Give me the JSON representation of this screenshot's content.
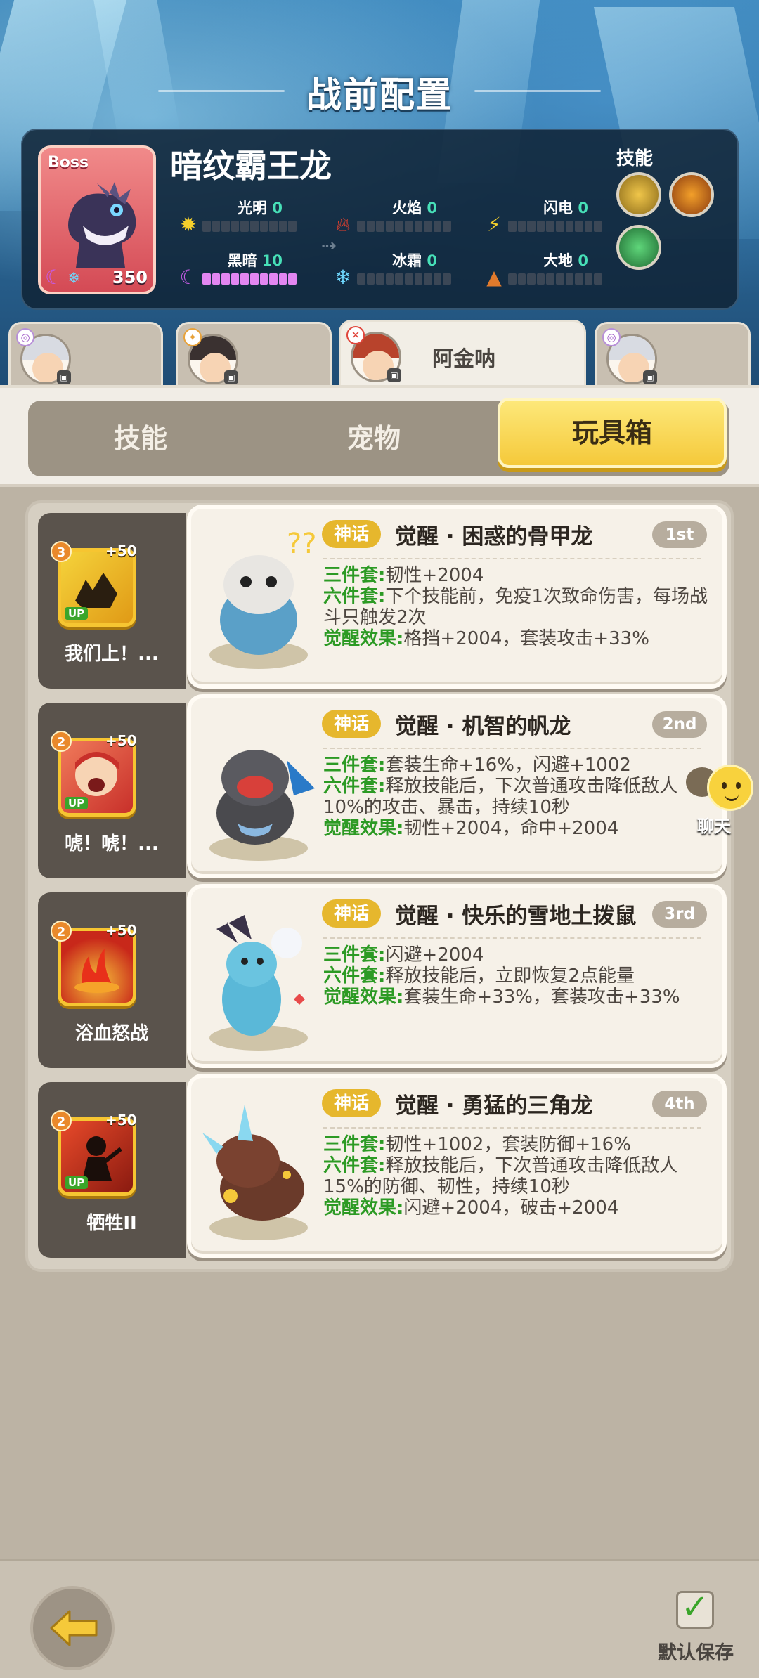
{
  "header": {
    "title": "战前配置"
  },
  "boss": {
    "tag": "Boss",
    "name": "暗纹霸王龙",
    "level": "350",
    "elements": [
      {
        "name": "光明",
        "value": "0",
        "filled": 0,
        "icon": "sun-icon"
      },
      {
        "name": "火焰",
        "value": "0",
        "filled": 0,
        "icon": "fire-icon"
      },
      {
        "name": "闪电",
        "value": "0",
        "filled": 0,
        "icon": "lightning-icon"
      },
      {
        "name": "黑暗",
        "value": "10",
        "filled": 10,
        "icon": "moon-icon"
      },
      {
        "name": "冰霜",
        "value": "0",
        "filled": 0,
        "icon": "snowflake-icon"
      },
      {
        "name": "大地",
        "value": "0",
        "filled": 0,
        "icon": "earth-icon"
      }
    ],
    "skills_label": "技能"
  },
  "heroes": [
    {
      "name": "",
      "active": false
    },
    {
      "name": "",
      "active": false
    },
    {
      "name": "阿金呐",
      "active": true
    },
    {
      "name": "",
      "active": false
    }
  ],
  "tabs": [
    {
      "label": "技能",
      "active": false
    },
    {
      "label": "宠物",
      "active": false
    },
    {
      "label": "玩具箱",
      "active": true
    }
  ],
  "toys": [
    {
      "skill_level": "3",
      "skill_plus": "+50",
      "skill_up": "UP",
      "skill_name": "我们上！...",
      "badge": "神话",
      "title": "觉醒 · 困惑的骨甲龙",
      "rank": "1st",
      "set3_label": "三件套:",
      "set3_text": "韧性+2004",
      "set6_label": "六件套:",
      "set6_text": "下个技能前，免疫1次致命伤害，每场战斗只触发2次",
      "awaken_label": "觉醒效果:",
      "awaken_text": "格挡+2004，套装攻击+33%"
    },
    {
      "skill_level": "2",
      "skill_plus": "+50",
      "skill_up": "UP",
      "skill_name": "唬！唬！...",
      "badge": "神话",
      "title": "觉醒 · 机智的帆龙",
      "rank": "2nd",
      "set3_label": "三件套:",
      "set3_text": "套装生命+16%，闪避+1002",
      "set6_label": "六件套:",
      "set6_text": "释放技能后，下次普通攻击降低敌人10%的攻击、暴击，持续10秒",
      "awaken_label": "觉醒效果:",
      "awaken_text": "韧性+2004，命中+2004"
    },
    {
      "skill_level": "2",
      "skill_plus": "+50",
      "skill_up": "",
      "skill_name": "浴血怒战",
      "badge": "神话",
      "title": "觉醒 · 快乐的雪地土拨鼠",
      "rank": "3rd",
      "set3_label": "三件套:",
      "set3_text": "闪避+2004",
      "set6_label": "六件套:",
      "set6_text": "释放技能后，立即恢复2点能量",
      "awaken_label": "觉醒效果:",
      "awaken_text": "套装生命+33%，套装攻击+33%"
    },
    {
      "skill_level": "2",
      "skill_plus": "+50",
      "skill_up": "UP",
      "skill_name": "牺牲II",
      "badge": "神话",
      "title": "觉醒 · 勇猛的三角龙",
      "rank": "4th",
      "set3_label": "三件套:",
      "set3_text": "韧性+1002，套装防御+16%",
      "set6_label": "六件套:",
      "set6_text": "释放技能后，下次普通攻击降低敌人15%的防御、韧性，持续10秒",
      "awaken_label": "觉醒效果:",
      "awaken_text": "闪避+2004，破击+2004"
    }
  ],
  "chat": {
    "label": "聊天"
  },
  "footer": {
    "save_label": "默认保存"
  },
  "colors": {
    "accent": "#f5c93a",
    "effect_green": "#2c9a24",
    "boss_card": "#d44a55"
  }
}
